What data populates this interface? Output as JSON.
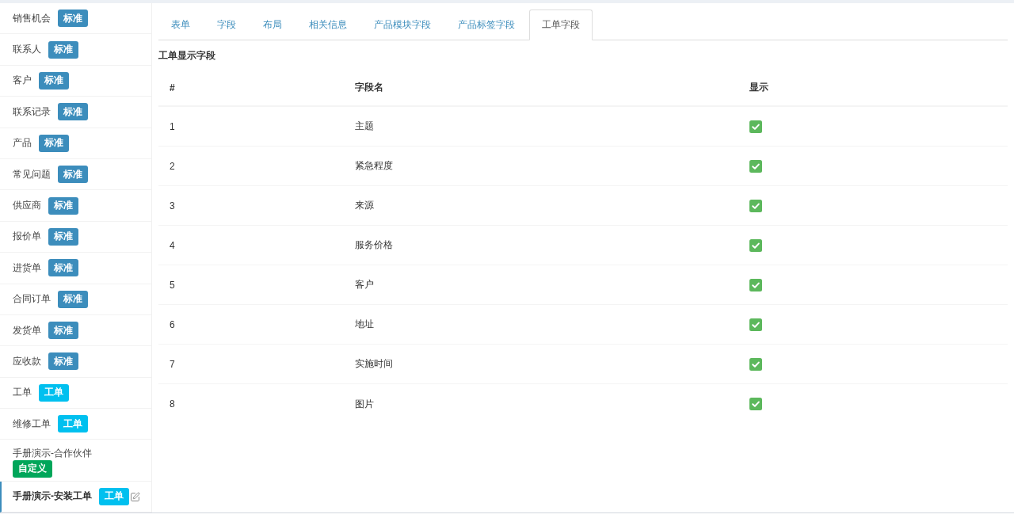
{
  "sidebar": {
    "items": [
      {
        "label": "销售机会",
        "badge": {
          "label": "标准",
          "color": "#3c8dbc"
        },
        "selected": false
      },
      {
        "label": "联系人",
        "badge": {
          "label": "标准",
          "color": "#3c8dbc"
        },
        "selected": false
      },
      {
        "label": "客户",
        "badge": {
          "label": "标准",
          "color": "#3c8dbc"
        },
        "selected": false
      },
      {
        "label": "联系记录",
        "badge": {
          "label": "标准",
          "color": "#3c8dbc"
        },
        "selected": false
      },
      {
        "label": "产品",
        "badge": {
          "label": "标准",
          "color": "#3c8dbc"
        },
        "selected": false
      },
      {
        "label": "常见问题",
        "badge": {
          "label": "标准",
          "color": "#3c8dbc"
        },
        "selected": false
      },
      {
        "label": "供应商",
        "badge": {
          "label": "标准",
          "color": "#3c8dbc"
        },
        "selected": false
      },
      {
        "label": "报价单",
        "badge": {
          "label": "标准",
          "color": "#3c8dbc"
        },
        "selected": false
      },
      {
        "label": "进货单",
        "badge": {
          "label": "标准",
          "color": "#3c8dbc"
        },
        "selected": false
      },
      {
        "label": "合同订单",
        "badge": {
          "label": "标准",
          "color": "#3c8dbc"
        },
        "selected": false
      },
      {
        "label": "发货单",
        "badge": {
          "label": "标准",
          "color": "#3c8dbc"
        },
        "selected": false
      },
      {
        "label": "应收款",
        "badge": {
          "label": "标准",
          "color": "#3c8dbc"
        },
        "selected": false
      },
      {
        "label": "工单",
        "badge": {
          "label": "工单",
          "color": "#00c0ef"
        },
        "selected": false
      },
      {
        "label": "维修工单",
        "badge": {
          "label": "工单",
          "color": "#00c0ef"
        },
        "selected": false
      },
      {
        "label": "手册演示-合作伙伴",
        "badge": {
          "label": "自定义",
          "color": "#00a65a"
        },
        "selected": false
      },
      {
        "label": "手册演示-安装工单",
        "badge": {
          "label": "工单",
          "color": "#00c0ef"
        },
        "selected": true
      }
    ]
  },
  "tabs": [
    {
      "label": "表单",
      "selected": false
    },
    {
      "label": "字段",
      "selected": false
    },
    {
      "label": "布局",
      "selected": false
    },
    {
      "label": "相关信息",
      "selected": false
    },
    {
      "label": "产品模块字段",
      "selected": false
    },
    {
      "label": "产品标签字段",
      "selected": false
    },
    {
      "label": "工单字段",
      "selected": true
    }
  ],
  "section_title": "工单显示字段",
  "table": {
    "columns": [
      "#",
      "字段名",
      "显示"
    ],
    "rows": [
      {
        "index": "1",
        "name": "主题",
        "shown": true
      },
      {
        "index": "2",
        "name": "紧急程度",
        "shown": true
      },
      {
        "index": "3",
        "name": "来源",
        "shown": true
      },
      {
        "index": "4",
        "name": "服务价格",
        "shown": true
      },
      {
        "index": "5",
        "name": "客户",
        "shown": true
      },
      {
        "index": "6",
        "name": "地址",
        "shown": true
      },
      {
        "index": "7",
        "name": "实施时间",
        "shown": true
      },
      {
        "index": "8",
        "name": "图片",
        "shown": true
      }
    ]
  }
}
